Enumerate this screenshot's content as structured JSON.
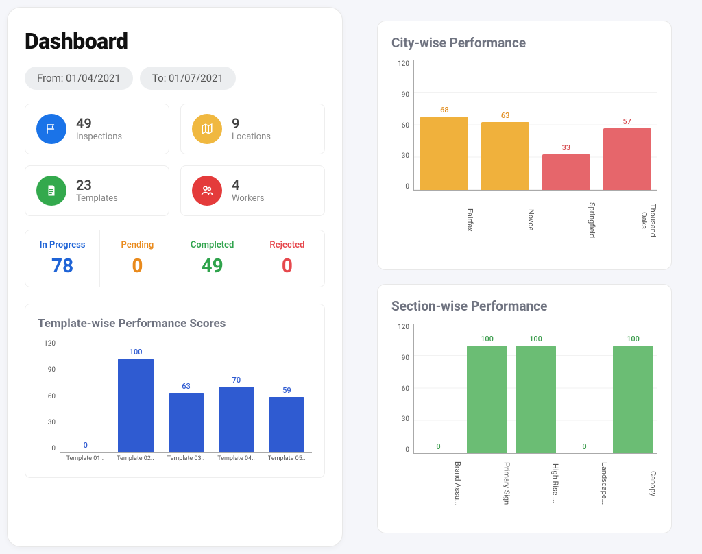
{
  "page_title": "Dashboard",
  "filters": {
    "from_label": "From: 01/04/2021",
    "to_label": "To: 01/07/2021"
  },
  "stats": {
    "inspections": {
      "value": "49",
      "label": "Inspections"
    },
    "locations": {
      "value": "9",
      "label": "Locations"
    },
    "templates": {
      "value": "23",
      "label": "Templates"
    },
    "workers": {
      "value": "4",
      "label": "Workers"
    }
  },
  "status": {
    "in_progress": {
      "label": "In Progress",
      "value": "78"
    },
    "pending": {
      "label": "Pending",
      "value": "0"
    },
    "completed": {
      "label": "Completed",
      "value": "49"
    },
    "rejected": {
      "label": "Rejected",
      "value": "0"
    }
  },
  "charts": {
    "template": {
      "title": "Template-wise Performance Scores",
      "y_ticks": [
        "120",
        "90",
        "60",
        "30",
        "0"
      ],
      "bars": [
        {
          "label": "Template 01..",
          "value": 0
        },
        {
          "label": "Template 02..",
          "value": 100
        },
        {
          "label": "Template 03..",
          "value": 63
        },
        {
          "label": "Template 04..",
          "value": 70
        },
        {
          "label": "Template 05..",
          "value": 59
        }
      ]
    },
    "city": {
      "title": "City-wise Performance",
      "y_ticks": [
        "120",
        "90",
        "60",
        "30",
        "0"
      ],
      "bars": [
        {
          "label": "Fairfax",
          "value": 68,
          "color": "orange"
        },
        {
          "label": "Novoe",
          "value": 63,
          "color": "orange"
        },
        {
          "label": "Springfield",
          "value": 33,
          "color": "red"
        },
        {
          "label": "Thousand Oaks",
          "value": 57,
          "color": "red"
        }
      ]
    },
    "section": {
      "title": "Section-wise Performance",
      "y_ticks": [
        "120",
        "90",
        "60",
        "30",
        "0"
      ],
      "bars": [
        {
          "label": "Brand Assu...",
          "value": 0
        },
        {
          "label": "Primary Sign",
          "value": 100
        },
        {
          "label": "High Rise ...",
          "value": 100
        },
        {
          "label": "Landscape...",
          "value": 0
        },
        {
          "label": "Canopy",
          "value": 100
        }
      ]
    }
  },
  "chart_data": [
    {
      "type": "bar",
      "title": "Template-wise Performance Scores",
      "categories": [
        "Template 01",
        "Template 02",
        "Template 03",
        "Template 04",
        "Template 05"
      ],
      "values": [
        0,
        100,
        63,
        70,
        59
      ],
      "ylim": [
        0,
        120
      ]
    },
    {
      "type": "bar",
      "title": "City-wise Performance",
      "categories": [
        "Fairfax",
        "Novoe",
        "Springfield",
        "Thousand Oaks"
      ],
      "values": [
        68,
        63,
        33,
        57
      ],
      "ylim": [
        0,
        120
      ]
    },
    {
      "type": "bar",
      "title": "Section-wise Performance",
      "categories": [
        "Brand Assurance",
        "Primary Sign",
        "High Rise",
        "Landscape",
        "Canopy"
      ],
      "values": [
        0,
        100,
        100,
        0,
        100
      ],
      "ylim": [
        0,
        120
      ]
    }
  ]
}
